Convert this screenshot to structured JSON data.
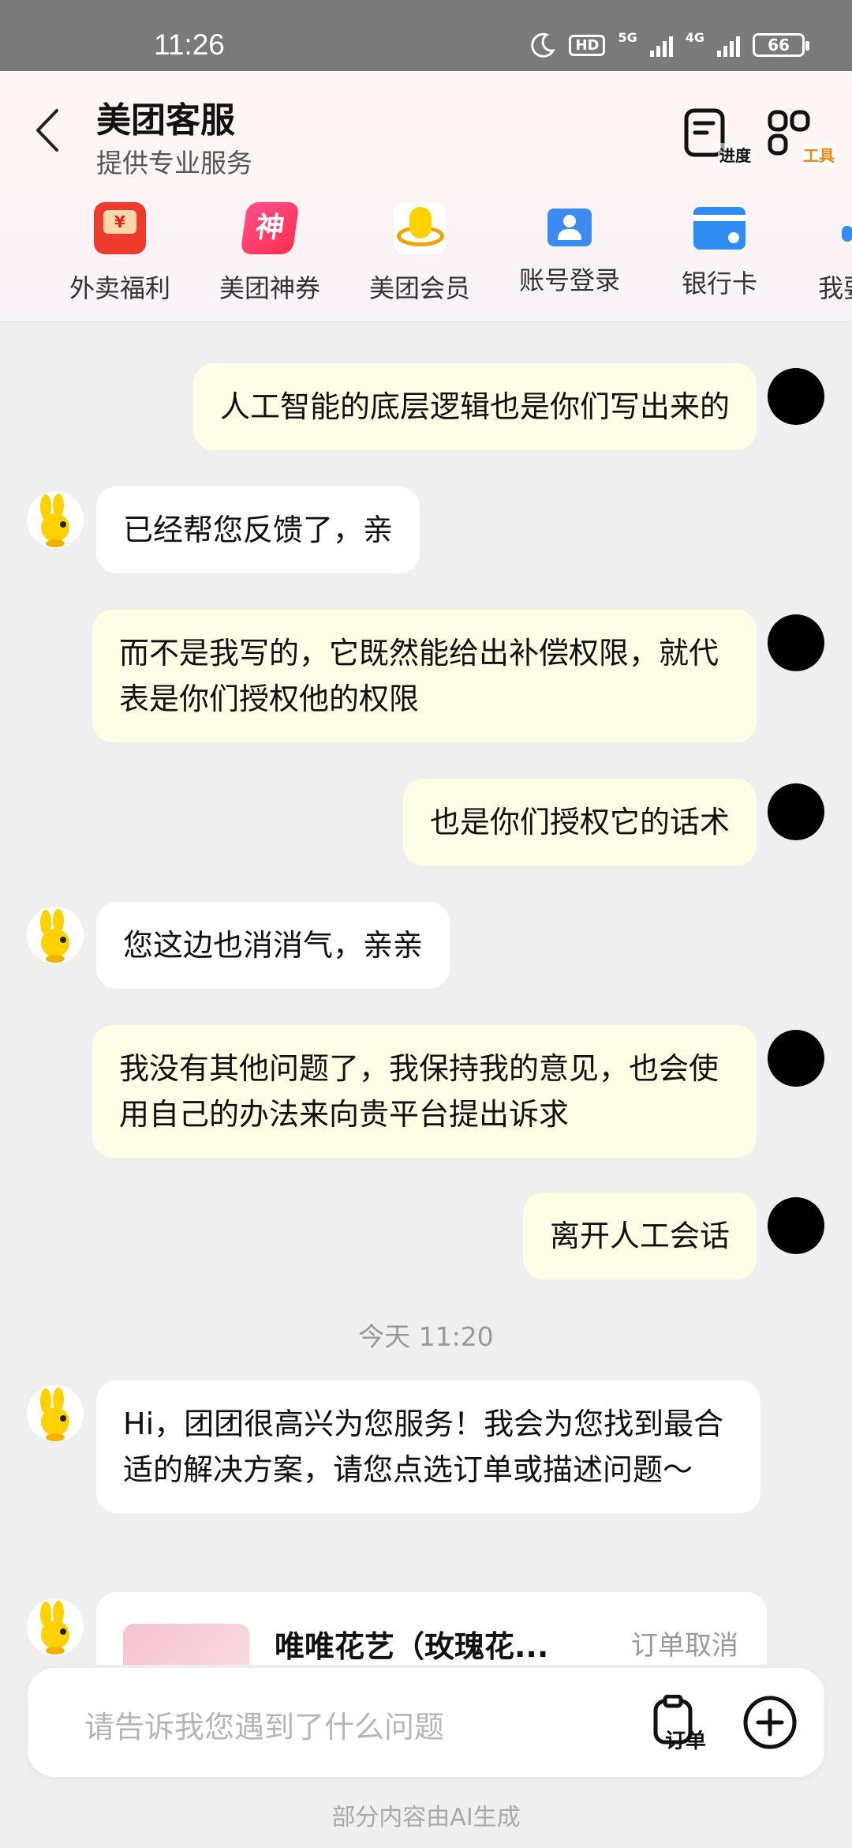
{
  "status_bar": {
    "time": "11:26",
    "hd_badge": "HD",
    "net1": "5G",
    "net2": "4G",
    "battery": "66"
  },
  "header": {
    "title": "美团客服",
    "subtitle": "提供专业服务",
    "tools": [
      {
        "label": "进度",
        "icon": "progress-icon"
      },
      {
        "label": "工具",
        "icon": "tools-grid-icon",
        "color": "#e88a14"
      }
    ]
  },
  "quick_entries": [
    {
      "label": "外卖福利",
      "icon": "red-envelope-icon"
    },
    {
      "label": "美团神券",
      "icon": "coupon-icon",
      "glyph": "神"
    },
    {
      "label": "美团会员",
      "icon": "member-kangaroo-icon"
    },
    {
      "label": "账号登录",
      "icon": "account-icon"
    },
    {
      "label": "银行卡",
      "icon": "bank-card-icon"
    },
    {
      "label": "我要",
      "icon": "more-icon"
    }
  ],
  "messages": [
    {
      "from": "user",
      "text": "人工智能的底层逻辑也是你们写出来的"
    },
    {
      "from": "agent",
      "text": "已经帮您反馈了，亲"
    },
    {
      "from": "user",
      "text": "而不是我写的，它既然能给出补偿权限，就代表是你们授权他的权限"
    },
    {
      "from": "user",
      "text": "也是你们授权它的话术"
    },
    {
      "from": "agent",
      "text": "您这边也消消气，亲亲"
    },
    {
      "from": "user",
      "text": "我没有其他问题了，我保持我的意见，也会使用自己的办法来向贵平台提出诉求"
    },
    {
      "from": "user",
      "text": "离开人工会话"
    },
    {
      "from": "agent",
      "text": "Hi，团团很高兴为您服务！我会为您找到最合适的解决方案，请您点选订单或描述问题～"
    }
  ],
  "timestamp": "今天 11:20",
  "order_card": {
    "name": "唯唯花艺（玫瑰花...",
    "status": "订单取消"
  },
  "input": {
    "placeholder": "请告诉我您遇到了什么问题",
    "order_label": "订单"
  },
  "footer_note": "部分内容由AI生成",
  "colors": {
    "user_bubble": "#fffde6",
    "agent_bubble": "#ffffff",
    "brand_yellow": "#ffd100",
    "tool_orange": "#e88a14"
  }
}
